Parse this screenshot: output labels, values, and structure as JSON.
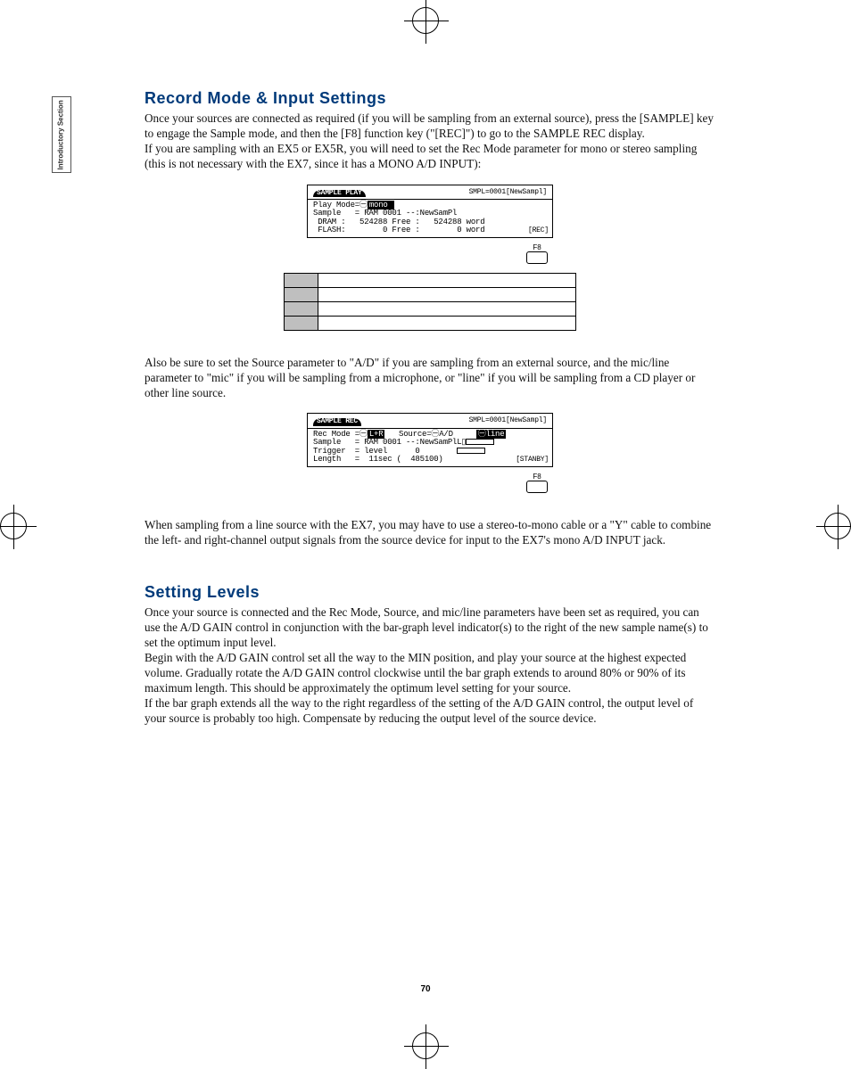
{
  "sidebar_label": "Introductory\nSection",
  "heading1": "Record Mode & Input Settings",
  "para1a": "Once your sources are connected as required (if you will be sampling from an external source), press the [SAMPLE] key to engage the Sample mode, and then the [F8] function key (\"[REC]\") to go to the SAMPLE REC display.",
  "para1b": "If you are sampling with an EX5 or EX5R, you will need to set the Rec Mode parameter for mono or stereo sampling (this is not necessary with the EX7, since it has a MONO A/D INPUT):",
  "lcd1": {
    "tab": "SAMPLE PLAY",
    "header_right": "SMPL=0001[NewSampl]",
    "lines": [
      "Play Mode=㊀mono",
      "Sample   = RAM 0001 --:NewSamPl",
      "",
      " DRAM :   524288 Free :   524288 word",
      " FLASH:        0 Free :        0 word"
    ],
    "corner": "[REC]"
  },
  "f8_label": "F8",
  "para2": "Also be sure to set the Source parameter to \"A/D\" if you are sampling from an external source, and the mic/line parameter to \"mic\" if you will be sampling from a microphone, or \"line\" if you will be sampling from a CD player or other line source.",
  "lcd2": {
    "tab": "SAMPLE REC",
    "header_right": "SMPL=0001[NewSampl]",
    "lines": [
      "Rec Mode =㊀L+R    Source=㊀A/D      ㊀line",
      "Sample   = RAM 0001 --:NewSamPlL▯",
      "",
      "Trigger  = level      0",
      "Length   =  11sec (  485100)"
    ],
    "corner": "[STANBY]"
  },
  "para3": "When sampling from a line source with the EX7, you may have to use a stereo-to-mono cable or a \"Y\" cable to combine the left- and right-channel output signals from the source device for input to the EX7's mono A/D INPUT jack.",
  "heading2": "Setting Levels",
  "para4a": "Once your source is connected and the Rec Mode, Source, and mic/line parameters have been set as required, you can use the A/D GAIN control in conjunction with the bar-graph level indicator(s) to the right of the new sample name(s) to set the optimum input level.",
  "para4b": "Begin with the A/D GAIN control set all the way to the MIN position, and play your source at the highest expected volume. Gradually rotate the A/D GAIN control clockwise until the bar graph extends to around 80% or 90% of its maximum length. This should be approximately the optimum level setting for your source.",
  "para4c": "If the bar graph extends all the way to the right regardless of the setting of the A/D GAIN control, the output level of your source is probably too high. Compensate by reducing the output level of the source device.",
  "page_number": "70"
}
